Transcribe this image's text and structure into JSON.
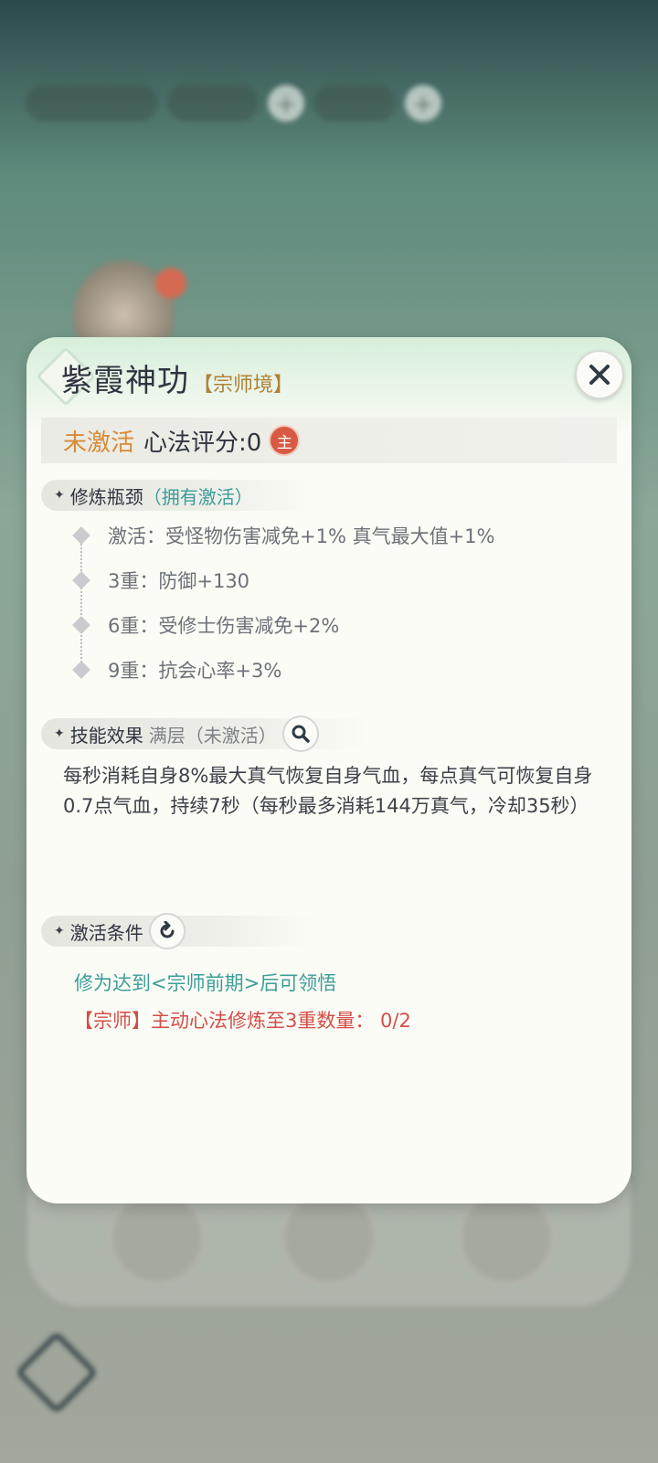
{
  "dialog": {
    "title": "紫霞神功",
    "realm": "【宗师境】",
    "status_label": "未激活",
    "score_label": "心法评分:0",
    "main_badge": "主",
    "sections": {
      "bottleneck": {
        "label": "修炼瓶颈",
        "hint": "（拥有激活）",
        "items": [
          "激活：受怪物伤害减免+1%  真气最大值+1%",
          "3重：防御+130",
          "6重：受修士伤害减免+2%",
          "9重：抗会心率+3%"
        ]
      },
      "skill": {
        "label": "技能效果",
        "hint": "满层（未激活）",
        "description": "每秒消耗自身8%最大真气恢复自身气血，每点真气可恢复自身0.7点气血，持续7秒（每秒最多消耗144万真气，冷却35秒）"
      },
      "conditions": {
        "label": "激活条件",
        "line1": "修为达到<宗师前期>后可领悟",
        "line2": "【宗师】主动心法修炼至3重数量： 0/2"
      }
    }
  },
  "colors": {
    "accent_orange": "#d88a35",
    "accent_teal": "#3c9d98",
    "accent_red": "#d24e48",
    "badge_red": "#d95a44"
  },
  "icons": [
    "close-icon",
    "search-icon",
    "refresh-icon",
    "diamond-bullet-icon"
  ]
}
